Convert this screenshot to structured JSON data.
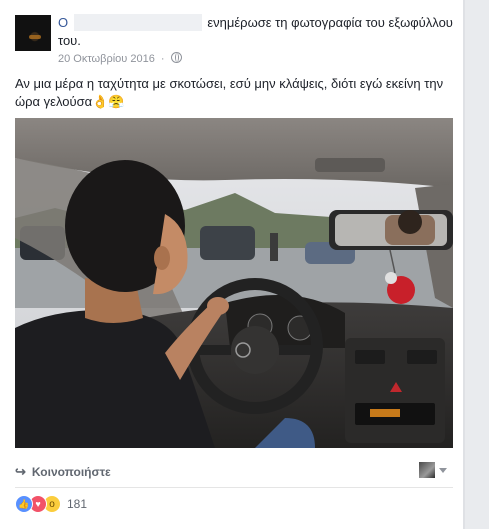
{
  "post": {
    "author_prefix": "Ο",
    "action_text": "ενημέρωσε τη φωτογραφία του εξωφύλλου του.",
    "date": "20 Οκτωβρίου 2016",
    "separator": "·",
    "privacy_icon": "globe-icon",
    "status_text": "Αν μια μέρα η ταχύτητα με σκοτώσει, εσύ μην κλάψεις, διότι εγώ εκείνη την ώρα γελούσα👌😤"
  },
  "actions": {
    "share_label": "Κοινοποιήστε",
    "share_icon": "↪"
  },
  "reactions": {
    "icons": [
      "like-icon",
      "love-icon",
      "wow-icon"
    ],
    "count": "181"
  },
  "colors": {
    "link": "#365899",
    "like": "#5890ff",
    "love": "#f25268",
    "wow": "#fbcd3d",
    "meta": "#90949c"
  }
}
